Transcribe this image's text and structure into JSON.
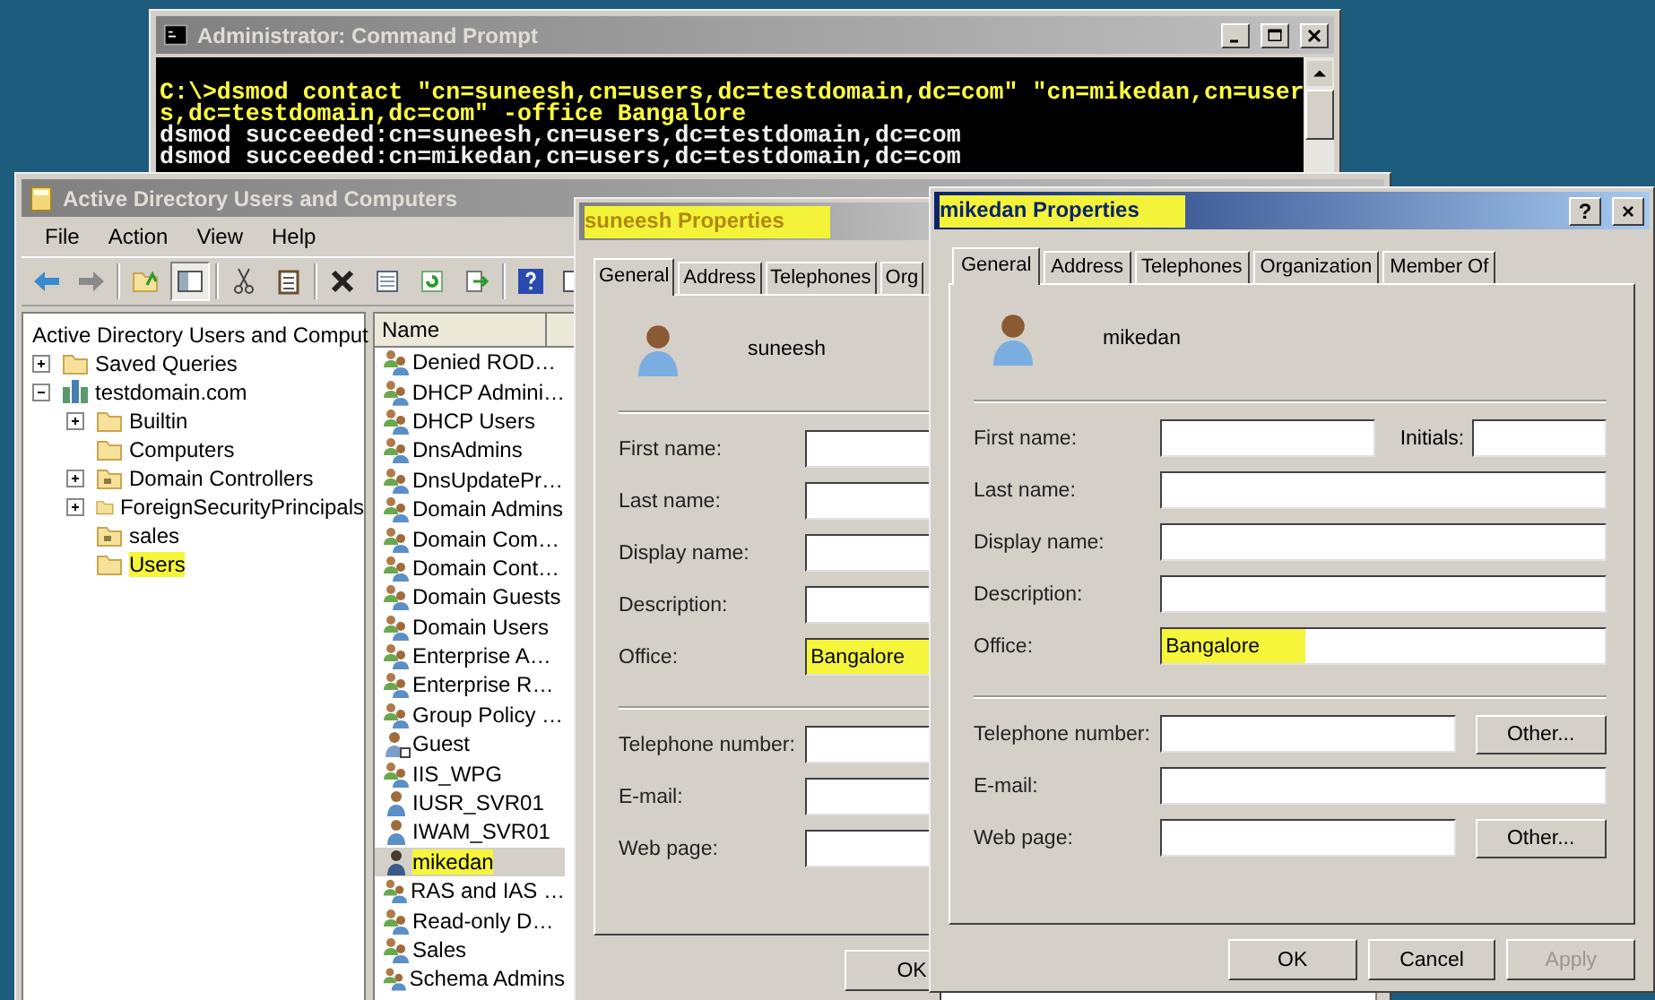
{
  "command_prompt": {
    "title": "Administrator: Command Prompt",
    "active": false,
    "lines": [
      {
        "kind": "command",
        "text": "C:\\>dsmod contact \"cn=suneesh,cn=users,dc=testdomain,dc=com\" \"cn=mikedan,cn=user"
      },
      {
        "kind": "command",
        "text": "s,dc=testdomain,dc=com\" -office Bangalore"
      },
      {
        "kind": "output",
        "text": "dsmod succeeded:cn=suneesh,cn=users,dc=testdomain,dc=com"
      },
      {
        "kind": "output",
        "text": "dsmod succeeded:cn=mikedan,cn=users,dc=testdomain,dc=com"
      }
    ]
  },
  "aduc": {
    "title": "Active Directory Users and Computers",
    "active": false,
    "menu": [
      "File",
      "Action",
      "View",
      "Help"
    ],
    "tree": [
      {
        "label": "Active Directory Users and Comput",
        "kind": "root",
        "highlighted": false,
        "children": [
          {
            "label": "Saved Queries",
            "kind": "folder",
            "expanded": false,
            "highlighted": false
          },
          {
            "label": "testdomain.com",
            "kind": "domain",
            "expanded": true,
            "highlighted": false,
            "children": [
              {
                "label": "Builtin",
                "kind": "folder",
                "expanded": false,
                "highlighted": false
              },
              {
                "label": "Computers",
                "kind": "folder",
                "highlighted": false
              },
              {
                "label": "Domain Controllers",
                "kind": "ou",
                "expanded": false,
                "highlighted": false
              },
              {
                "label": "ForeignSecurityPrincipals",
                "kind": "folder",
                "expanded": false,
                "highlighted": false
              },
              {
                "label": "sales",
                "kind": "ou",
                "highlighted": false
              },
              {
                "label": "Users",
                "kind": "folder",
                "highlighted": true
              }
            ]
          }
        ]
      }
    ],
    "list": {
      "columns": [
        "Name"
      ],
      "items": [
        {
          "name": "Denied ROD…",
          "kind": "group",
          "selected": false,
          "highlighted": false
        },
        {
          "name": "DHCP Admini…",
          "kind": "group",
          "selected": false,
          "highlighted": false
        },
        {
          "name": "DHCP Users",
          "kind": "group",
          "selected": false,
          "highlighted": false
        },
        {
          "name": "DnsAdmins",
          "kind": "group",
          "selected": false,
          "highlighted": false
        },
        {
          "name": "DnsUpdatePr…",
          "kind": "group",
          "selected": false,
          "highlighted": false
        },
        {
          "name": "Domain Admins",
          "kind": "group",
          "selected": false,
          "highlighted": false
        },
        {
          "name": "Domain Com…",
          "kind": "group",
          "selected": false,
          "highlighted": false
        },
        {
          "name": "Domain Cont…",
          "kind": "group",
          "selected": false,
          "highlighted": false
        },
        {
          "name": "Domain Guests",
          "kind": "group",
          "selected": false,
          "highlighted": false
        },
        {
          "name": "Domain Users",
          "kind": "group",
          "selected": false,
          "highlighted": false
        },
        {
          "name": "Enterprise A…",
          "kind": "group",
          "selected": false,
          "highlighted": false
        },
        {
          "name": "Enterprise R…",
          "kind": "group",
          "selected": false,
          "highlighted": false
        },
        {
          "name": "Group Policy …",
          "kind": "group",
          "selected": false,
          "highlighted": false
        },
        {
          "name": "Guest",
          "kind": "guest",
          "selected": false,
          "highlighted": false
        },
        {
          "name": "IIS_WPG",
          "kind": "group",
          "selected": false,
          "highlighted": false
        },
        {
          "name": "IUSR_SVR01",
          "kind": "user",
          "selected": false,
          "highlighted": false
        },
        {
          "name": "IWAM_SVR01",
          "kind": "user",
          "selected": false,
          "highlighted": false
        },
        {
          "name": "mikedan",
          "kind": "contact",
          "selected": true,
          "highlighted": true
        },
        {
          "name": "RAS and IAS …",
          "kind": "group",
          "selected": false,
          "highlighted": false
        },
        {
          "name": "Read-only D…",
          "kind": "group",
          "selected": false,
          "highlighted": false
        },
        {
          "name": "Sales",
          "kind": "group",
          "selected": false,
          "highlighted": false
        },
        {
          "name": "Schema Admins",
          "kind": "group",
          "selected": false,
          "highlighted": false
        }
      ]
    }
  },
  "dialogs": [
    {
      "title": "suneesh Properties",
      "active": false,
      "title_highlighted": true,
      "tabs": [
        {
          "label": "General",
          "selected": true
        },
        {
          "label": "Address",
          "selected": false
        },
        {
          "label": "Telephones",
          "selected": false
        },
        {
          "label": "Org",
          "selected": false
        }
      ],
      "user": "suneesh",
      "field_groups": [
        [
          {
            "label": "First name:",
            "kind": "text"
          },
          {
            "label": "Last name:",
            "kind": "text"
          },
          {
            "label": "Display name:",
            "kind": "text"
          },
          {
            "label": "Description:",
            "kind": "text"
          },
          {
            "label": "Office:",
            "kind": "text",
            "value": "Bangalore",
            "highlighted": true
          }
        ],
        [
          {
            "label": "Telephone number:",
            "kind": "text"
          },
          {
            "label": "E-mail:",
            "kind": "text"
          },
          {
            "label": "Web page:",
            "kind": "text"
          }
        ]
      ],
      "buttons": [
        {
          "label": "OK",
          "disabled": false
        }
      ]
    },
    {
      "title": "mikedan Properties",
      "active": true,
      "title_highlighted": true,
      "title_buttons": [
        "?",
        "×"
      ],
      "tabs": [
        {
          "label": "General",
          "selected": true
        },
        {
          "label": "Address",
          "selected": false
        },
        {
          "label": "Telephones",
          "selected": false
        },
        {
          "label": "Organization",
          "selected": false
        },
        {
          "label": "Member Of",
          "selected": false
        }
      ],
      "user": "mikedan",
      "field_groups": [
        [
          {
            "label": "First name:",
            "kind": "initials",
            "extra_label": "Initials:"
          },
          {
            "label": "Last name:",
            "kind": "text"
          },
          {
            "label": "Display name:",
            "kind": "text"
          },
          {
            "label": "Description:",
            "kind": "text"
          },
          {
            "label": "Office:",
            "kind": "text",
            "value": "Bangalore",
            "highlighted": true
          }
        ],
        [
          {
            "label": "Telephone number:",
            "kind": "other",
            "button": "Other..."
          },
          {
            "label": "E-mail:",
            "kind": "text"
          },
          {
            "label": "Web page:",
            "kind": "other",
            "button": "Other..."
          }
        ]
      ],
      "buttons": [
        {
          "label": "OK",
          "disabled": false
        },
        {
          "label": "Cancel",
          "disabled": false
        },
        {
          "label": "Apply",
          "disabled": true
        }
      ]
    }
  ]
}
